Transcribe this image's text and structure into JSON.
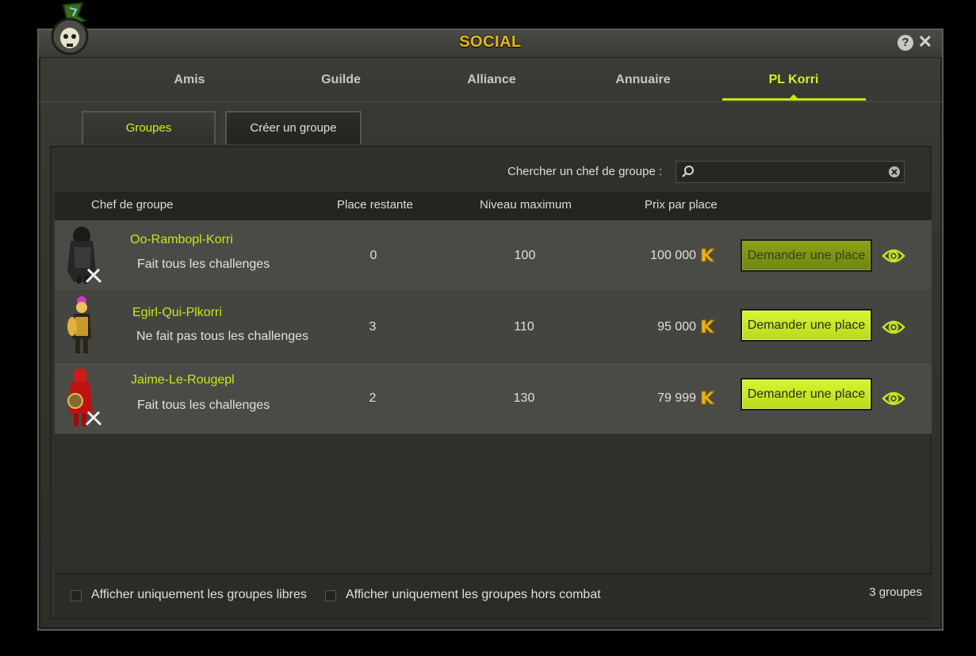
{
  "window": {
    "title": "SOCIAL",
    "help_label": "?",
    "close_label": "✕"
  },
  "tabs": [
    {
      "label": "Amis",
      "active": false
    },
    {
      "label": "Guilde",
      "active": false
    },
    {
      "label": "Alliance",
      "active": false
    },
    {
      "label": "Annuaire",
      "active": false
    },
    {
      "label": "PL Korri",
      "active": true
    }
  ],
  "subtabs": [
    {
      "label": "Groupes",
      "active": true
    },
    {
      "label": "Créer un groupe",
      "active": false
    }
  ],
  "search": {
    "label": "Chercher un chef de groupe :",
    "value": ""
  },
  "table": {
    "headers": [
      "Chef de groupe",
      "Place restante",
      "Niveau maximum",
      "Prix par place"
    ],
    "rows": [
      {
        "leader": "Oo-Rambopl-Korri",
        "description": "Fait tous les challenges",
        "places": "0",
        "level": "100",
        "price": "100 000",
        "button": "Demander une place",
        "button_enabled": false
      },
      {
        "leader": "Egirl-Qui-Plkorri",
        "description": "Ne fait pas tous les challenges",
        "places": "3",
        "level": "110",
        "price": "95 000",
        "button": "Demander une place",
        "button_enabled": true
      },
      {
        "leader": "Jaime-Le-Rougepl",
        "description": "Fait tous les challenges",
        "places": "2",
        "level": "130",
        "price": "79 999",
        "button": "Demander une place",
        "button_enabled": true
      }
    ]
  },
  "footer": {
    "filter_free": "Afficher uniquement les groupes libres",
    "filter_out_of_combat": "Afficher uniquement les groupes hors combat",
    "count": "3 groupes"
  },
  "colors": {
    "accent": "#c8e51e",
    "title": "#e9b61e",
    "kama": "#e8b418"
  }
}
